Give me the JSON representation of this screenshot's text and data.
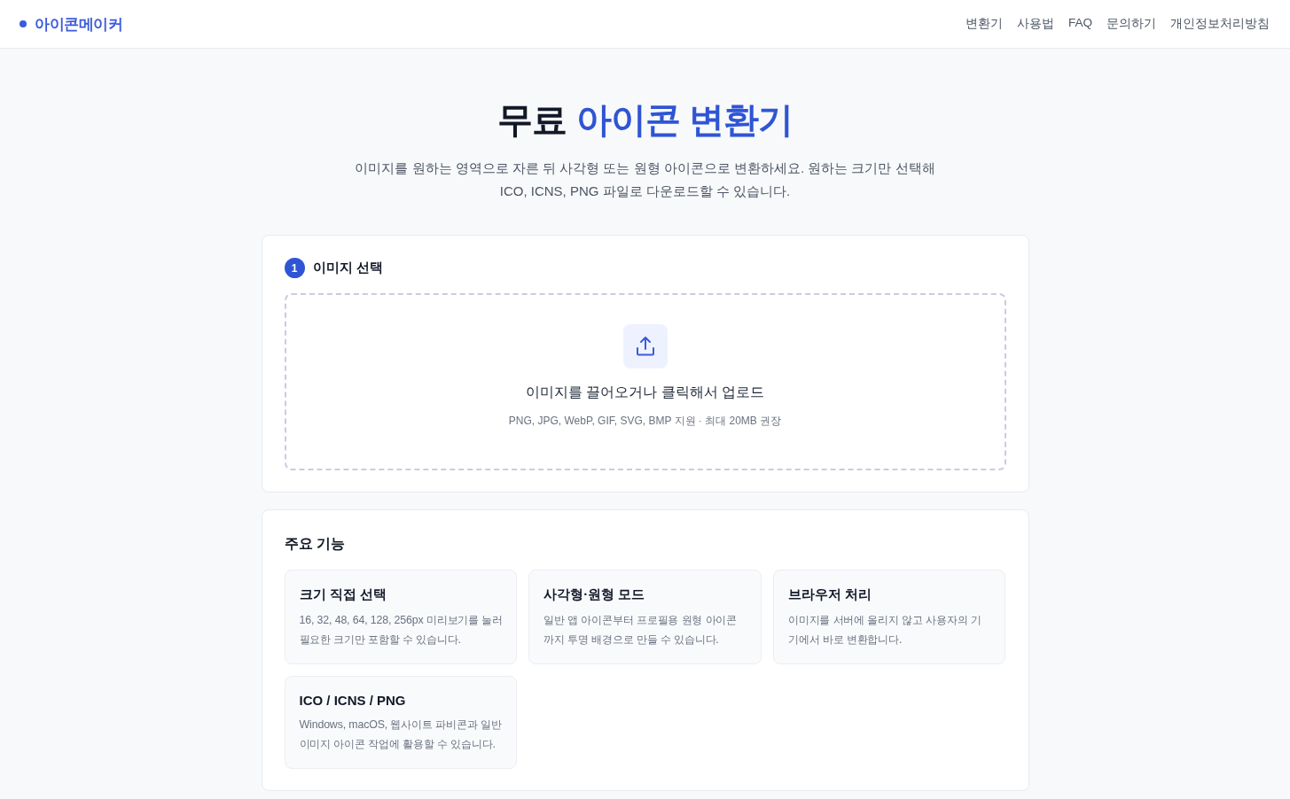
{
  "header": {
    "logo": "아이콘메이커",
    "nav": [
      "변환기",
      "사용법",
      "FAQ",
      "문의하기",
      "개인정보처리방침"
    ]
  },
  "hero": {
    "title": "무료",
    "title_highlight": "아이콘 변환기",
    "subtitle": "이미지를 원하는 영역으로 자른 뒤 사각형 또는 원형 아이콘으로 변환하세요. 원하는 크기만 선택해 ICO, ICNS, PNG 파일로 다운로드할 수 있습니다."
  },
  "upload_card": {
    "step": "1",
    "heading": "이미지 선택",
    "dropzone": {
      "label": "이미지를 끌어오거나 클릭해서 업로드",
      "hint": "PNG, JPG, WebP, GIF, SVG, BMP 지원 · 최대 20MB 권장"
    }
  },
  "features": {
    "heading": "주요 기능",
    "items": [
      {
        "title": "크기 직접 선택",
        "description": "16, 32, 48, 64, 128, 256px 미리보기를 눌러 필요한 크기만 포함할 수 있습니다."
      },
      {
        "title": "사각형·원형 모드",
        "description": "일반 앱 아이콘부터 프로필용 원형 아이콘까지 투명 배경으로 만들 수 있습니다."
      },
      {
        "title": "브라우저 처리",
        "description": "이미지를 서버에 올리지 않고 사용자의 기기에서 바로 변환합니다."
      },
      {
        "title": "ICO / ICNS / PNG",
        "description": "Windows, macOS, 웹사이트 파비콘과 일반 이미지 아이콘 작업에 활용할 수 있습니다."
      }
    ]
  }
}
